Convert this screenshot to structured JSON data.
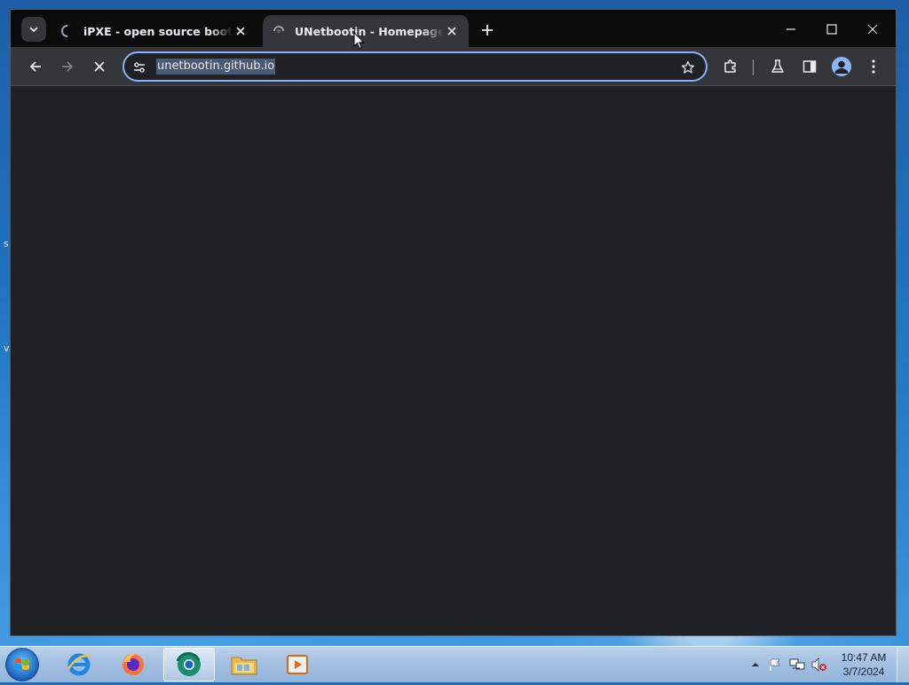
{
  "browser": {
    "tabs": [
      {
        "title": "iPXE - open source boot firmware",
        "state": "loading",
        "active": false
      },
      {
        "title": "UNetbootin - Homepage and Downloads",
        "state": "loading",
        "active": true
      }
    ],
    "new_tab_icon": "plus-icon",
    "window_controls": [
      "minimize-icon",
      "maximize-icon",
      "close-icon"
    ],
    "toolbar": {
      "back_icon": "arrow-left-icon",
      "forward_icon": "arrow-right-icon",
      "stop_icon": "close-icon",
      "site_info_icon": "tune-icon",
      "url": "unetbootin.github.io",
      "bookmark_icon": "star-icon",
      "extensions_icon": "puzzle-icon",
      "labs_icon": "flask-icon",
      "side_panel_icon": "side-panel-icon",
      "profile_icon": "avatar-icon",
      "menu_icon": "kebab-menu-icon"
    },
    "content_background": "#202124",
    "accent": "#8ab4f8"
  },
  "desktop": {
    "edge_glyphs": [
      "s",
      "v"
    ]
  },
  "taskbar": {
    "apps": [
      "internet-explorer-icon",
      "firefox-icon",
      "chrome-icon",
      "file-explorer-icon",
      "media-player-icon"
    ],
    "active_app": "chrome-icon",
    "tray": [
      "show-hidden-icons",
      "flag-icon",
      "network-icon",
      "volume-muted-icon"
    ],
    "clock": {
      "time": "10:47 AM",
      "date": "3/7/2024"
    }
  }
}
